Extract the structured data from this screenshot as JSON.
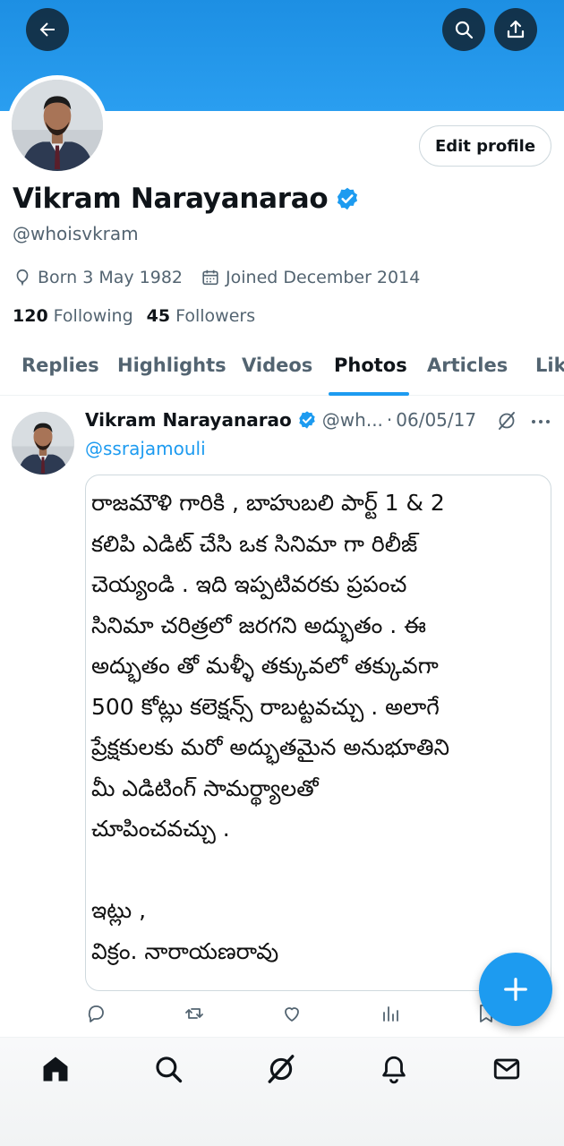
{
  "profile": {
    "name": "Vikram Narayanarao",
    "handle": "@whoisvkram",
    "born": "Born 3 May 1982",
    "joined": "Joined December 2014",
    "following_count": "120",
    "following_label": "Following",
    "followers_count": "45",
    "followers_label": "Followers",
    "edit_label": "Edit profile"
  },
  "tabs": [
    {
      "label": "Replies"
    },
    {
      "label": "Highlights"
    },
    {
      "label": "Videos"
    },
    {
      "label": "Photos",
      "active": true
    },
    {
      "label": "Articles"
    },
    {
      "label": "Lik"
    }
  ],
  "post": {
    "author": "Vikram Narayanarao",
    "handle": "@wh...",
    "separator": "·",
    "date": "06/05/17",
    "mention": "@ssrajamouli",
    "image_text": "రాజమౌళి గారికి , బాహుబలి పార్ట్ 1 & 2\nకలిపి ఎడిట్ చేసి ఒక సినిమా గా రిలీజ్\nచెయ్యండి . ఇది ఇప్పటివరకు ప్రపంచ\nసినిమా చరిత్రలో జరగని అద్భుతం . ఈ\nఅద్భుతం తో మళ్ళీ తక్కువలో తక్కువగా\n500 కోట్లు కలెక్షన్స్ రాబట్టవచ్చు . అలాగే\nప్రేక్షకులకు మరో అద్భుతమైన అనుభూతిని\nమీ ఎడిటింగ్ సామర్థ్యాలతో\nచూపించవచ్చు .\n\nఇట్లు ,\nవిక్రం. నారాయణరావు"
  },
  "colors": {
    "accent": "#1d9bf0",
    "banner": "#2a9ef0",
    "text_secondary": "#536471"
  },
  "icons": {
    "back": "arrow-left-icon",
    "search": "search-icon",
    "share": "share-icon",
    "verified": "verified-badge-icon",
    "grok": "grok-icon",
    "more": "more-icon",
    "reply": "reply-icon",
    "repost": "repost-icon",
    "like": "like-icon",
    "views": "views-icon",
    "bookmark": "bookmark-icon",
    "compose": "plus-icon",
    "home": "home-icon",
    "explore": "search-icon",
    "grok_nav": "grok-icon",
    "notifications": "bell-icon",
    "messages": "mail-icon"
  }
}
